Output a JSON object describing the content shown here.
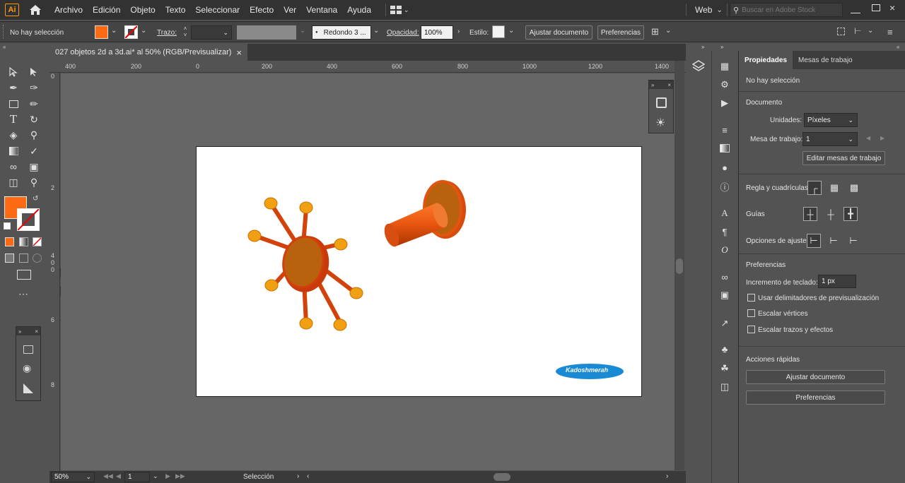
{
  "app": {
    "logo": "Ai",
    "workspace": "Web",
    "stock_search_placeholder": "Buscar en Adobe Stock"
  },
  "menu": [
    "Archivo",
    "Edición",
    "Objeto",
    "Texto",
    "Seleccionar",
    "Efecto",
    "Ver",
    "Ventana",
    "Ayuda"
  ],
  "control": {
    "selection_status": "No hay selección",
    "stroke_label": "Trazo:",
    "brush": "Redondo 3 ...",
    "opacity_label": "Opacidad:",
    "opacity_value": "100%",
    "style_label": "Estilo:",
    "adjust_doc": "Ajustar documento",
    "preferences": "Preferencias",
    "fill_color": "#ff6a13"
  },
  "document": {
    "tab_title": "027 objetos 2d a 3d.ai* al 50% (RGB/Previsualizar)",
    "close": "×"
  },
  "ruler_top": [
    "400",
    "200",
    "0",
    "200",
    "400",
    "600",
    "800",
    "1000",
    "1200",
    "1400"
  ],
  "ruler_left": [
    "0",
    "2",
    "4 0 0",
    "6",
    "8"
  ],
  "status": {
    "zoom": "50%",
    "page": "1",
    "tool": "Selección"
  },
  "artwork": {
    "watermark": "Kadoshmerah"
  },
  "properties": {
    "tabs": [
      "Propiedades",
      "Mesas de trabajo"
    ],
    "no_selection": "No hay selección",
    "document_section": "Documento",
    "units_label": "Unidades:",
    "units_value": "Píxeles",
    "artboard_label": "Mesa de trabajo:",
    "artboard_value": "1",
    "edit_artboards": "Editar mesas de trabajo",
    "rulers_grids": "Regla y cuadrículas",
    "guides": "Guías",
    "snap_options": "Opciones de ajuste",
    "preferences_section": "Preferencias",
    "keyboard_increment_label": "Incremento de teclado:",
    "keyboard_increment_value": "1 px",
    "use_preview_bounds": "Usar delimitadores de previsualización",
    "scale_corners": "Escalar vértices",
    "scale_strokes": "Escalar trazos y efectos",
    "quick_actions": "Acciones rápidas",
    "adjust_doc": "Ajustar documento",
    "preferences_btn": "Preferencias"
  }
}
